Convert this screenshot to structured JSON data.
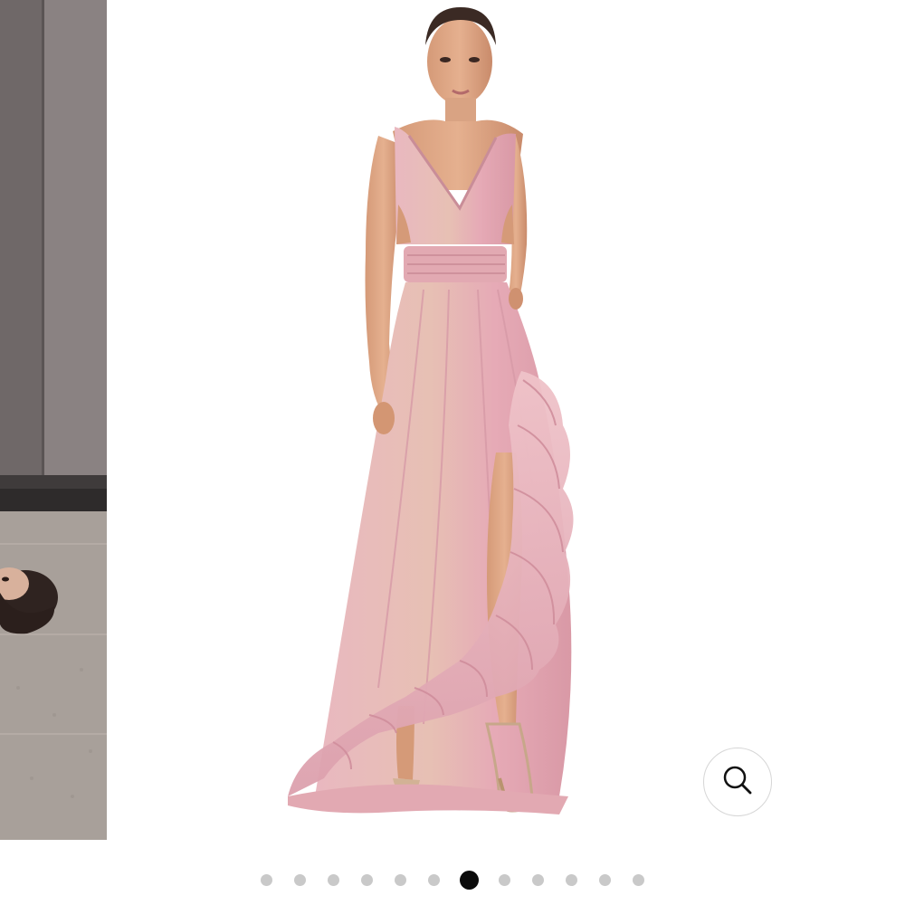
{
  "gallery": {
    "previous_slide": {
      "icon": "photo-left-edge"
    },
    "current_slide": {
      "icon": "product-photo-pink-gown"
    },
    "zoom_button": {
      "icon": "magnifier-icon"
    },
    "pagination": {
      "total": 12,
      "active_index": 6
    }
  },
  "colors": {
    "active_dot": "#0b0b0b",
    "inactive_dot": "#c9c9c9",
    "dress_pink": "#e8b4bd",
    "dress_shadow": "#c98d98"
  }
}
